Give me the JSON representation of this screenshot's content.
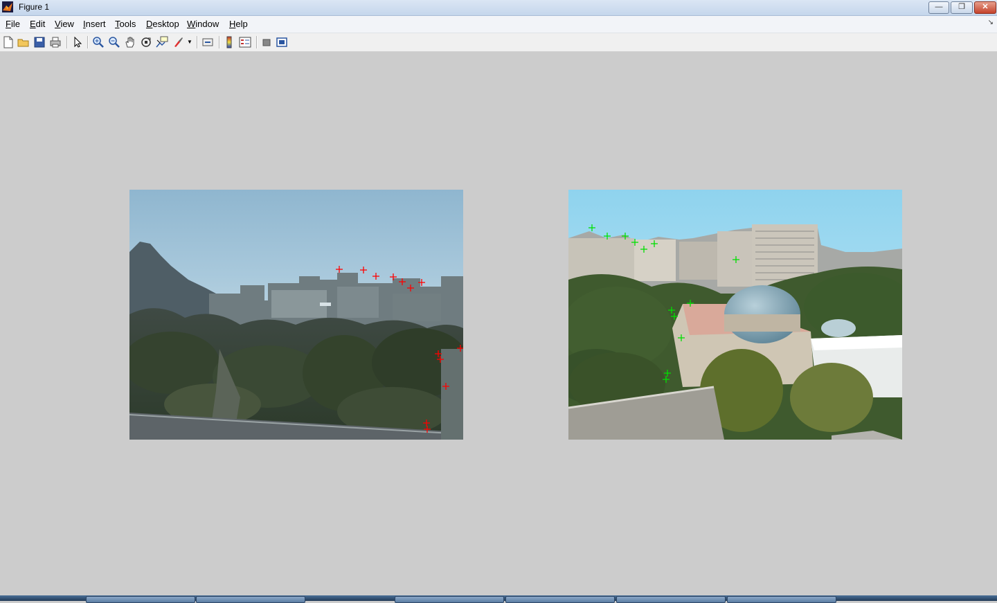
{
  "window": {
    "title": "Figure 1",
    "minimize_icon": "minimize-icon",
    "maximize_icon": "restore-icon",
    "close_icon": "close-icon"
  },
  "menu": {
    "items": [
      {
        "label": "File"
      },
      {
        "label": "Edit"
      },
      {
        "label": "View"
      },
      {
        "label": "Insert"
      },
      {
        "label": "Tools"
      },
      {
        "label": "Desktop"
      },
      {
        "label": "Window"
      },
      {
        "label": "Help"
      }
    ]
  },
  "toolbar": {
    "icons": [
      "new-figure-icon",
      "open-file-icon",
      "save-icon",
      "print-icon",
      "edit-plot-arrow-icon",
      "zoom-in-icon",
      "zoom-out-icon",
      "pan-hand-icon",
      "rotate-3d-icon",
      "data-cursor-icon",
      "brush-icon",
      "link-plot-icon",
      "insert-colorbar-icon",
      "insert-legend-icon",
      "hide-plot-tools-icon",
      "show-plot-tools-icon"
    ]
  },
  "colors": {
    "left_markers": "#ff0000",
    "right_markers": "#00e000",
    "figure_background": "#cccccc"
  },
  "images": [
    {
      "name": "left-photo",
      "marker_color": "red",
      "marker": "+"
    },
    {
      "name": "right-photo",
      "marker_color": "green",
      "marker": "+"
    }
  ]
}
